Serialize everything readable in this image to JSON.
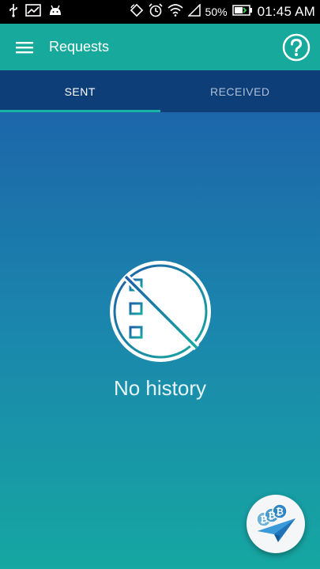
{
  "status_bar": {
    "battery": "50%",
    "time": "01:45 AM",
    "icons": [
      "usb-icon",
      "chart-icon",
      "android-icon",
      "rotate-icon",
      "alarm-icon",
      "wifi-icon",
      "signal-icon",
      "battery-icon"
    ]
  },
  "appbar": {
    "title": "Requests",
    "menu_icon": "hamburger-menu-icon",
    "help_icon": "help-icon",
    "color": "#16a99c"
  },
  "tabs": [
    {
      "label": "SENT",
      "active": true
    },
    {
      "label": "RECEIVED",
      "active": false
    }
  ],
  "empty_state": {
    "message": "No history",
    "icon": "no-history-icon"
  },
  "fab": {
    "icon": "send-bitcoin-icon"
  },
  "colors": {
    "tab_bar": "#0e3e78",
    "tab_indicator": "#17b3a3",
    "gradient_top": "#1c66a9",
    "gradient_bottom": "#16a7a2"
  }
}
